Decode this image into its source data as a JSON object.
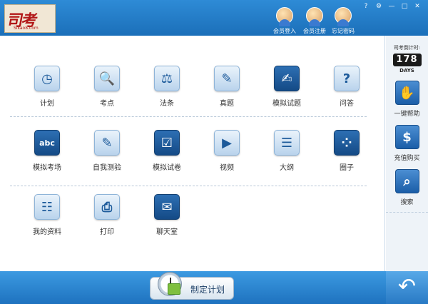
{
  "header": {
    "logo_text": "司考",
    "logo_sub": "Sikao8.com",
    "window_controls": [
      "?",
      "⚙",
      "—",
      "□",
      "✕"
    ],
    "buttons": [
      {
        "label": "会员登入",
        "icon": "user-login-icon"
      },
      {
        "label": "会员注册",
        "icon": "user-register-icon"
      },
      {
        "label": "忘记密码",
        "icon": "forgot-password-icon"
      }
    ]
  },
  "grid": {
    "row1": [
      {
        "label": "计划",
        "icon": "calendar-clock-icon",
        "glyph": "◷"
      },
      {
        "label": "考点",
        "icon": "document-search-icon",
        "glyph": "🔍"
      },
      {
        "label": "法条",
        "icon": "scales-icon",
        "glyph": "⚖"
      },
      {
        "label": "真题",
        "icon": "edit-icon",
        "glyph": "✎"
      },
      {
        "label": "模拟试题",
        "icon": "pen-paper-icon",
        "glyph": "✍"
      },
      {
        "label": "问答",
        "icon": "question-icon",
        "glyph": "?"
      }
    ],
    "row2": [
      {
        "label": "模拟考场",
        "icon": "blackboard-icon",
        "glyph": "abc"
      },
      {
        "label": "自我测验",
        "icon": "test-sheet-icon",
        "glyph": "✎"
      },
      {
        "label": "模拟试卷",
        "icon": "checklist-icon",
        "glyph": "☑"
      },
      {
        "label": "视频",
        "icon": "film-icon",
        "glyph": "▶"
      },
      {
        "label": "大纲",
        "icon": "outline-doc-icon",
        "glyph": "☰"
      },
      {
        "label": "圈子",
        "icon": "circle-apps-icon",
        "glyph": "⁘"
      }
    ],
    "row3": [
      {
        "label": "我的资料",
        "icon": "profile-card-icon",
        "glyph": "☷"
      },
      {
        "label": "打印",
        "icon": "printer-icon",
        "glyph": "⎙"
      },
      {
        "label": "聊天室",
        "icon": "chat-icon",
        "glyph": "✉"
      }
    ]
  },
  "side": {
    "countdown_title": "司考倒计时:",
    "countdown_value": "178",
    "countdown_unit": "DAYS",
    "buttons": [
      {
        "label": "一键帮助",
        "icon": "handshake-icon",
        "glyph": "✋"
      },
      {
        "label": "充值购买",
        "icon": "dollar-icon",
        "glyph": "$"
      },
      {
        "label": "搜索",
        "icon": "magnifier-icon",
        "glyph": "⌕"
      }
    ]
  },
  "footer": {
    "plan_button": "制定计划",
    "back_icon": "↶"
  }
}
